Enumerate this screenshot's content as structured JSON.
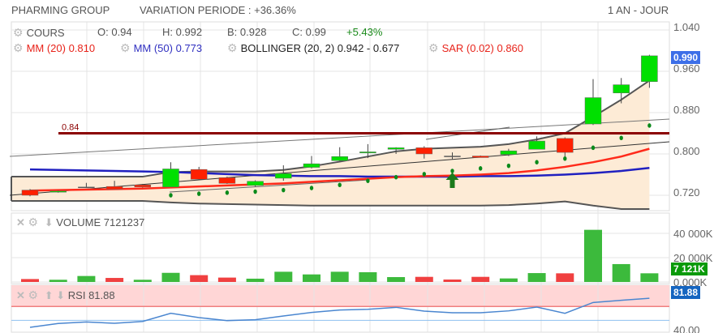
{
  "header": {
    "title": "PHARMING GROUP",
    "variation": "VARIATION PERIODE : +36.36%",
    "period": "1 AN - JOUR"
  },
  "legend": {
    "cours_label": "COURS",
    "open": "O: 0.94",
    "high": "H: 0.992",
    "low": "B: 0.928",
    "close": "C: 0.99",
    "change": "+5.43%",
    "mm20": "MM (20) 0.810",
    "mm50": "MM (50) 0.773",
    "bollinger": "BOLLINGER (20, 2) 0.942 - 0.677",
    "sar": "SAR (0.02) 0.860"
  },
  "icons": {
    "settings": "gear-icon",
    "close": "x-icon",
    "down": "arrow-down-icon",
    "up": "arrow-up-icon",
    "signal": "buy-arrow-icon"
  },
  "colors": {
    "up": "#00e000",
    "down": "#ff2000",
    "mm20": "#ff2a1a",
    "mm50": "#2020c0",
    "sar": "#0a8a1a",
    "band_fill": "#fdebd6",
    "level": "#8b0000",
    "price_tag": "#3d6fe8",
    "volume_tag": "#0a9a0a",
    "rsi_tag": "#1565c0"
  },
  "volume_panel": {
    "label": "VOLUME 7121237",
    "tag": "7 121K"
  },
  "rsi_panel": {
    "label": "RSI 81.88",
    "tag": "81.88"
  },
  "chart_data": [
    {
      "type": "candlestick",
      "yaxis_ticks": [
        "1.040",
        "0.960",
        "0.880",
        "0.800",
        "0.720"
      ],
      "ylim": [
        0.687,
        1.04
      ],
      "price_tag": "0.990",
      "level_line": {
        "value": 0.84,
        "label": "0.84"
      },
      "candles": [
        [
          0.73,
          0.732,
          0.718,
          0.72
        ],
        [
          0.726,
          0.729,
          0.725,
          0.728
        ],
        [
          0.736,
          0.744,
          0.735,
          0.736
        ],
        [
          0.737,
          0.748,
          0.732,
          0.732
        ],
        [
          0.74,
          0.742,
          0.735,
          0.736
        ],
        [
          0.736,
          0.784,
          0.736,
          0.771
        ],
        [
          0.77,
          0.775,
          0.749,
          0.751
        ],
        [
          0.754,
          0.756,
          0.742,
          0.743
        ],
        [
          0.739,
          0.749,
          0.737,
          0.747
        ],
        [
          0.753,
          0.778,
          0.748,
          0.762
        ],
        [
          0.774,
          0.796,
          0.772,
          0.781
        ],
        [
          0.787,
          0.813,
          0.786,
          0.795
        ],
        [
          0.802,
          0.819,
          0.792,
          0.804
        ],
        [
          0.809,
          0.813,
          0.8,
          0.812
        ],
        [
          0.812,
          0.815,
          0.791,
          0.8
        ],
        [
          0.796,
          0.803,
          0.79,
          0.796
        ],
        [
          0.796,
          0.797,
          0.793,
          0.793
        ],
        [
          0.799,
          0.81,
          0.796,
          0.806
        ],
        [
          0.809,
          0.834,
          0.809,
          0.825
        ],
        [
          0.83,
          0.832,
          0.795,
          0.803
        ],
        [
          0.858,
          0.945,
          0.856,
          0.909
        ],
        [
          0.918,
          0.947,
          0.898,
          0.934
        ],
        [
          0.94,
          0.992,
          0.928,
          0.99
        ]
      ],
      "mm20": [
        0.729,
        0.73,
        0.731,
        0.732,
        0.733,
        0.735,
        0.737,
        0.739,
        0.741,
        0.743,
        0.746,
        0.749,
        0.752,
        0.755,
        0.757,
        0.758,
        0.76,
        0.763,
        0.768,
        0.775,
        0.784,
        0.795,
        0.81
      ],
      "mm50": [
        0.77,
        0.769,
        0.768,
        0.767,
        0.766,
        0.765,
        0.763,
        0.761,
        0.759,
        0.758,
        0.757,
        0.757,
        0.756,
        0.756,
        0.756,
        0.756,
        0.757,
        0.757,
        0.758,
        0.76,
        0.763,
        0.767,
        0.773
      ],
      "bollinger_upper": [
        0.756,
        0.756,
        0.756,
        0.756,
        0.756,
        0.765,
        0.766,
        0.766,
        0.766,
        0.769,
        0.776,
        0.785,
        0.795,
        0.805,
        0.81,
        0.812,
        0.814,
        0.819,
        0.828,
        0.84,
        0.872,
        0.905,
        0.942
      ],
      "bollinger_lower": [
        0.709,
        0.709,
        0.709,
        0.709,
        0.709,
        0.706,
        0.704,
        0.703,
        0.702,
        0.701,
        0.7,
        0.7,
        0.7,
        0.7,
        0.7,
        0.7,
        0.7,
        0.701,
        0.704,
        0.708,
        0.7,
        0.692,
        0.686
      ],
      "sar": [
        null,
        null,
        null,
        null,
        null,
        0.72,
        0.723,
        0.725,
        0.727,
        0.73,
        0.734,
        0.74,
        0.748,
        0.755,
        0.761,
        0.767,
        0.772,
        0.777,
        0.784,
        0.791,
        0.812,
        0.831,
        0.855
      ],
      "buy_signal_index": 15
    },
    {
      "type": "bar",
      "yaxis_ticks": [
        "40 000K",
        "20 000K",
        "0.000K"
      ],
      "ylim": [
        0,
        40000
      ],
      "values_k": [
        2400,
        1800,
        4900,
        3300,
        1800,
        7500,
        5600,
        3600,
        2700,
        8400,
        6200,
        8400,
        8000,
        4000,
        4200,
        2000,
        4200,
        2900,
        7300,
        7100,
        42900,
        14700,
        7121
      ],
      "direction": [
        "down",
        "up",
        "up",
        "down",
        "up",
        "up",
        "down",
        "down",
        "up",
        "up",
        "up",
        "up",
        "up",
        "up",
        "down",
        "down",
        "down",
        "up",
        "up",
        "down",
        "up",
        "up",
        "up"
      ]
    },
    {
      "type": "line",
      "yaxis_ticks": [
        "40.00"
      ],
      "overbought": 70,
      "midline": 50,
      "values": [
        40.0,
        45.5,
        47.8,
        45.8,
        48.5,
        60.2,
        54.0,
        49.7,
        50.9,
        56.3,
        61.4,
        64.9,
        66.0,
        68.8,
        63.3,
        61.0,
        61.0,
        63.7,
        69.2,
        60.2,
        75.8,
        78.9,
        81.88
      ]
    }
  ]
}
